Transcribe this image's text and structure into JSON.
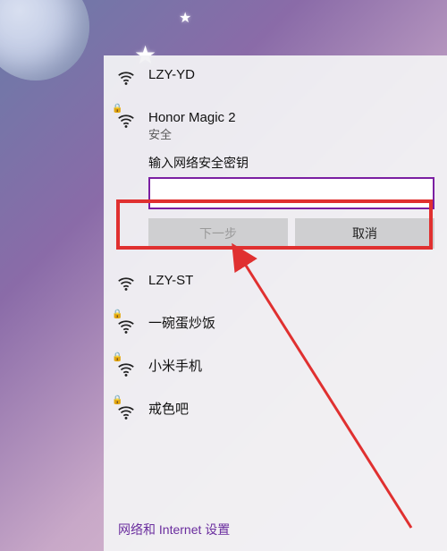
{
  "networks": [
    {
      "name": "LZY-YD",
      "secured": false,
      "expanded": false
    },
    {
      "name": "Honor Magic 2",
      "secured": true,
      "expanded": true,
      "subtitle": "安全"
    },
    {
      "name": "LZY-ST",
      "secured": false,
      "expanded": false
    },
    {
      "name": "一碗蛋炒饭",
      "secured": true,
      "expanded": false
    },
    {
      "name": "小米手机",
      "secured": true,
      "expanded": false
    },
    {
      "name": "戒色吧",
      "secured": true,
      "expanded": false
    }
  ],
  "password_prompt": {
    "label": "输入网络安全密钥",
    "value": "",
    "next_label": "下一步",
    "cancel_label": "取消"
  },
  "settings_link": "网络和 Internet 设置"
}
